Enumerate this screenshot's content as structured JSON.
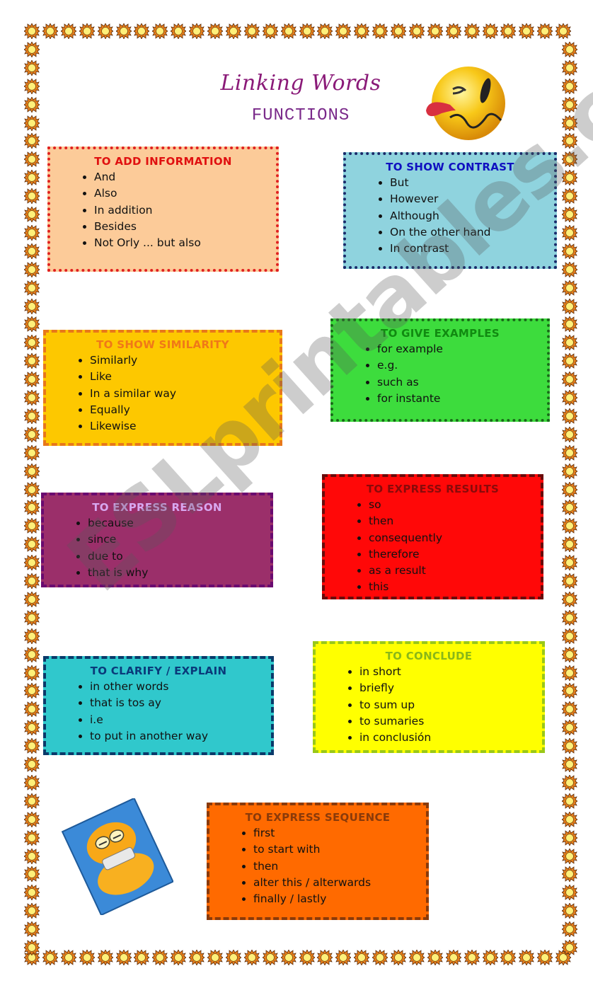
{
  "header": {
    "title": "Linking Words",
    "subtitle": "FUNCTIONS"
  },
  "images": {
    "smiley": "winking-tongue-smiley",
    "garfield": "garfield-grinning-card"
  },
  "watermark": "ESLprintables.com",
  "boxes": [
    {
      "heading": "TO ADD INFORMATION",
      "items": [
        "And",
        "Also",
        "In addition",
        "Besides",
        "Not Orly ... but also"
      ],
      "bg": "#fccb99",
      "border": "#e02020",
      "heading_color": "#e01010"
    },
    {
      "heading": "TO SHOW CONTRAST",
      "items": [
        "But",
        "However",
        "Although",
        "On the other hand",
        "In contrast"
      ],
      "bg": "#8fd3de",
      "border": "#1a2a6a",
      "heading_color": "#1010c0"
    },
    {
      "heading": "TO SHOW SIMILARITY",
      "items": [
        "Similarly",
        "Like",
        "In a similar way",
        "Equally",
        "Likewise"
      ],
      "bg": "#fdc800",
      "border": "#e8781a",
      "heading_color": "#f07818"
    },
    {
      "heading": "TO GIVE EXAMPLES",
      "items": [
        "for example",
        "e.g.",
        "such as",
        "for instante"
      ],
      "bg": "#3ddc3d",
      "border": "#1a6a1a",
      "heading_color": "#118a11"
    },
    {
      "heading": "TO EXPRESS REASON",
      "items": [
        "because",
        "since",
        "due to",
        "that is why"
      ],
      "bg": "#9b2f6a",
      "border": "#6a0a70",
      "heading_color": "#d8a8f0"
    },
    {
      "heading": "TO EXPRESS RESULTS",
      "items": [
        "so",
        "then",
        "consequently",
        "therefore",
        "as a result",
        "this"
      ],
      "bg": "#ff0808",
      "border": "#6a0a0a",
      "heading_color": "#8a0a0a"
    },
    {
      "heading": "TO CLARIFY / EXPLAIN",
      "items": [
        "in other words",
        "that is tos ay",
        "i.e",
        "to put in another way"
      ],
      "bg": "#30c8cc",
      "border": "#0a3a6a",
      "heading_color": "#0a3a7a"
    },
    {
      "heading": "TO CONCLUDE",
      "items": [
        "in short",
        "briefly",
        "to sum up",
        "to sumaries",
        "in conclusión"
      ],
      "bg": "#ffff00",
      "border": "#9ac818",
      "heading_color": "#8ab818"
    },
    {
      "heading": "TO EXPRESS SEQUENCE",
      "items": [
        "first",
        "to start with",
        "then",
        "alter this / alterwards",
        "finally / lastly"
      ],
      "bg": "#ff6a00",
      "border": "#8a3a0a",
      "heading_color": "#8a3a0a"
    }
  ]
}
